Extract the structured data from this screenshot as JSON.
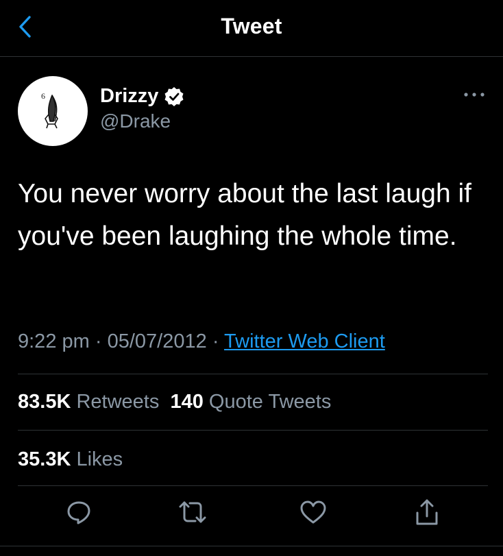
{
  "topbar": {
    "title": "Tweet",
    "back_icon": "chevron-left-icon"
  },
  "tweet": {
    "author": {
      "display_name": "Drizzy",
      "handle": "@Drake",
      "verified": true,
      "avatar_mark": "6"
    },
    "text": "You never worry about the last laugh if you've been laughing the whole time.",
    "meta": {
      "time": "9:22 pm",
      "separator": "·",
      "date": "05/07/2012",
      "client": "Twitter Web Client"
    },
    "stats": {
      "retweets_count": "83.5K",
      "retweets_label": "Retweets",
      "quote_count": "140",
      "quote_label": "Quote Tweets",
      "likes_count": "35.3K",
      "likes_label": "Likes"
    },
    "actions": [
      "reply-icon",
      "retweet-icon",
      "like-icon",
      "share-icon"
    ]
  },
  "colors": {
    "background": "#000000",
    "text": "#ffffff",
    "secondary": "#8b98a5",
    "accent": "#1d9bf0",
    "divider": "#2f3336"
  }
}
